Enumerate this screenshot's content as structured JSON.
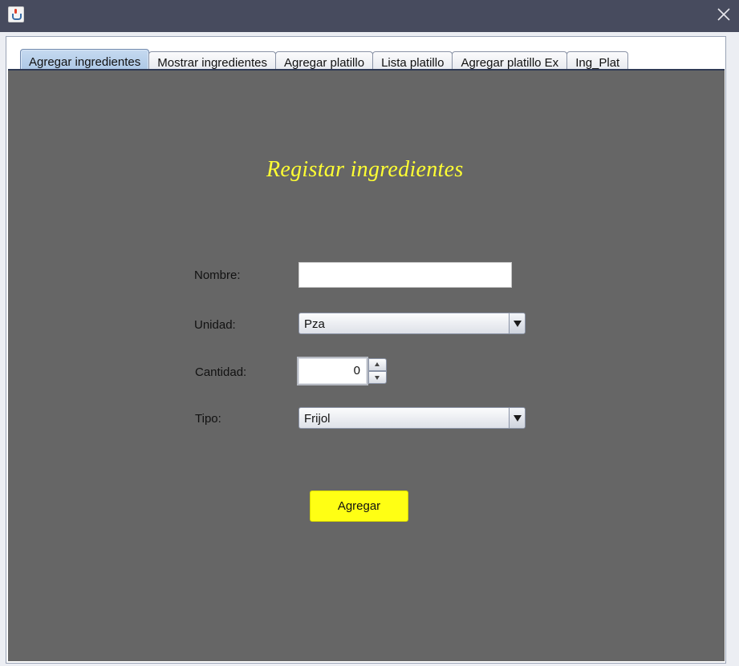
{
  "window": {
    "title": "",
    "icons": {
      "app": "java-icon",
      "close": "close-icon"
    }
  },
  "tabs": [
    {
      "label": "Agregar ingredientes",
      "active": true
    },
    {
      "label": "Mostrar ingredientes",
      "active": false
    },
    {
      "label": "Agregar platillo",
      "active": false
    },
    {
      "label": "Lista platillo",
      "active": false
    },
    {
      "label": "Agregar platillo Ex",
      "active": false
    },
    {
      "label": "Ing_Plat",
      "active": false
    }
  ],
  "form": {
    "heading": "Registar ingredientes",
    "nombre": {
      "label": "Nombre:",
      "value": "",
      "placeholder": ""
    },
    "unidad": {
      "label": "Unidad:",
      "selected": "Pza"
    },
    "cantidad": {
      "label": "Cantidad:",
      "value": "0"
    },
    "tipo": {
      "label": "Tipo:",
      "selected": "Frijol"
    },
    "submit_label": "Agregar"
  },
  "colors": {
    "content_bg": "#666666",
    "heading": "#ffff33",
    "button_bg": "#ffff14",
    "titlebar": "#474b5e"
  }
}
